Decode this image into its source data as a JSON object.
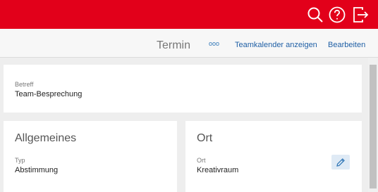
{
  "topbar": {
    "search_icon": "search-icon",
    "help_icon": "help-icon",
    "exit_icon": "exit-icon",
    "accent": "#e2001a"
  },
  "commandbar": {
    "title": "Termin",
    "more_label": "ooo",
    "team_calendar_label": "Teamkalender anzeigen",
    "edit_label": "Bearbeiten"
  },
  "subject": {
    "label": "Betreff",
    "value": "Team-Besprechung"
  },
  "general": {
    "heading": "Allgemeines",
    "type_label": "Typ",
    "type_value": "Abstimmung"
  },
  "location": {
    "heading": "Ort",
    "label": "Ort",
    "value": "Kreativraum",
    "edit_icon": "pencil-icon"
  }
}
